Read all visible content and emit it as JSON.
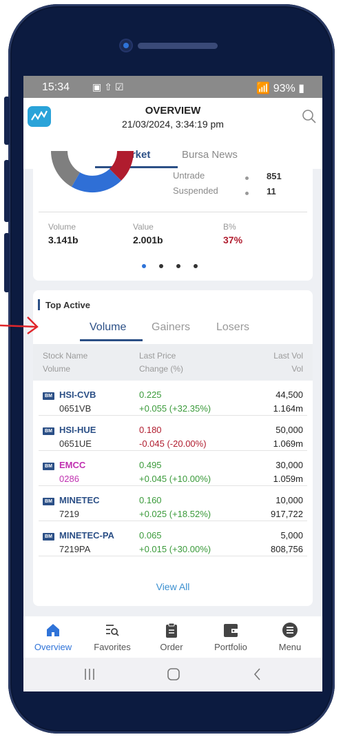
{
  "status": {
    "time": "15:34",
    "battery": "93%"
  },
  "header": {
    "title": "OVERVIEW",
    "datetime": "21/03/2024, 3:34:19 pm"
  },
  "tabs": {
    "market": "Market",
    "news": "Bursa News"
  },
  "market_stats": [
    {
      "label": "Untrade",
      "value": "851"
    },
    {
      "label": "Suspended",
      "value": "11"
    }
  ],
  "summary": {
    "volume_label": "Volume",
    "volume": "3.141b",
    "value_label": "Value",
    "value": "2.001b",
    "b_label": "B%",
    "b_value": "37%"
  },
  "top_active": {
    "title": "Top Active",
    "tabs": [
      "Volume",
      "Gainers",
      "Losers"
    ],
    "headers": {
      "stock": "Stock Name",
      "volume": "Volume",
      "last_price": "Last Price",
      "change": "Change (%)",
      "last_vol": "Last Vol",
      "vol": "Vol"
    },
    "rows": [
      {
        "code": "HSI-CVB",
        "sub": "0651VB",
        "price": "0.225",
        "change": "+0.055 (+32.35%)",
        "last_vol": "44,500",
        "vol": "1.164m",
        "dir": "up"
      },
      {
        "code": "HSI-HUE",
        "sub": "0651UE",
        "price": "0.180",
        "change": "-0.045 (-20.00%)",
        "last_vol": "50,000",
        "vol": "1.069m",
        "dir": "down"
      },
      {
        "code": "EMCC",
        "sub": "0286",
        "price": "0.495",
        "change": "+0.045 (+10.00%)",
        "last_vol": "30,000",
        "vol": "1.059m",
        "dir": "up"
      },
      {
        "code": "MINETEC",
        "sub": "7219",
        "price": "0.160",
        "change": "+0.025 (+18.52%)",
        "last_vol": "10,000",
        "vol": "917,722",
        "dir": "up"
      },
      {
        "code": "MINETEC-PA",
        "sub": "7219PA",
        "price": "0.065",
        "change": "+0.015 (+30.00%)",
        "last_vol": "5,000",
        "vol": "808,756",
        "dir": "up"
      }
    ],
    "badge": "BM",
    "view_all": "View All"
  },
  "nav": [
    "Overview",
    "Favorites",
    "Order",
    "Portfolio",
    "Menu"
  ],
  "colors": {
    "accent": "#2b4f86",
    "up": "#3a9a3a",
    "down": "#b01c2e",
    "link": "#3a8fd0"
  }
}
